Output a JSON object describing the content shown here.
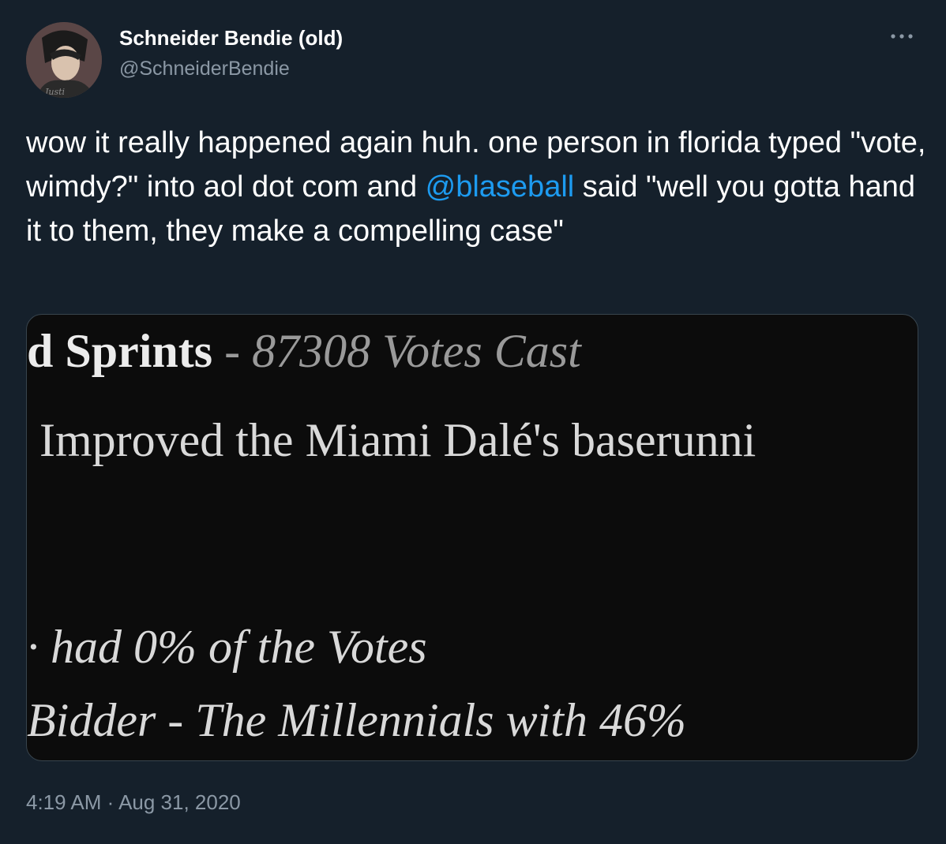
{
  "author": {
    "name": "Schneider Bendie (old)",
    "handle": "@SchneiderBendie",
    "avatar_text": "Justi"
  },
  "tweet": {
    "text_before": "wow it really happened again huh. one person in florida typed \"vote, wimdy?\" into aol dot com and ",
    "mention": "@blaseball",
    "text_after": " said \"well you gotta hand it to them, they make a compelling case\"",
    "timestamp": "4:19 AM · Aug 31, 2020"
  },
  "media": {
    "line1_bold": "d Sprints",
    "line1_italic": " - 87308 Votes Cast",
    "line2": "Improved the Miami Dalé's baserunni",
    "line3": "· had 0% of the Votes",
    "line4": "Bidder - The Millennials with 46%"
  },
  "colors": {
    "background": "#15202b",
    "accent": "#1d9bf0",
    "secondary_text": "#8b98a5"
  },
  "icons": {
    "more": "more-horizontal-icon"
  }
}
